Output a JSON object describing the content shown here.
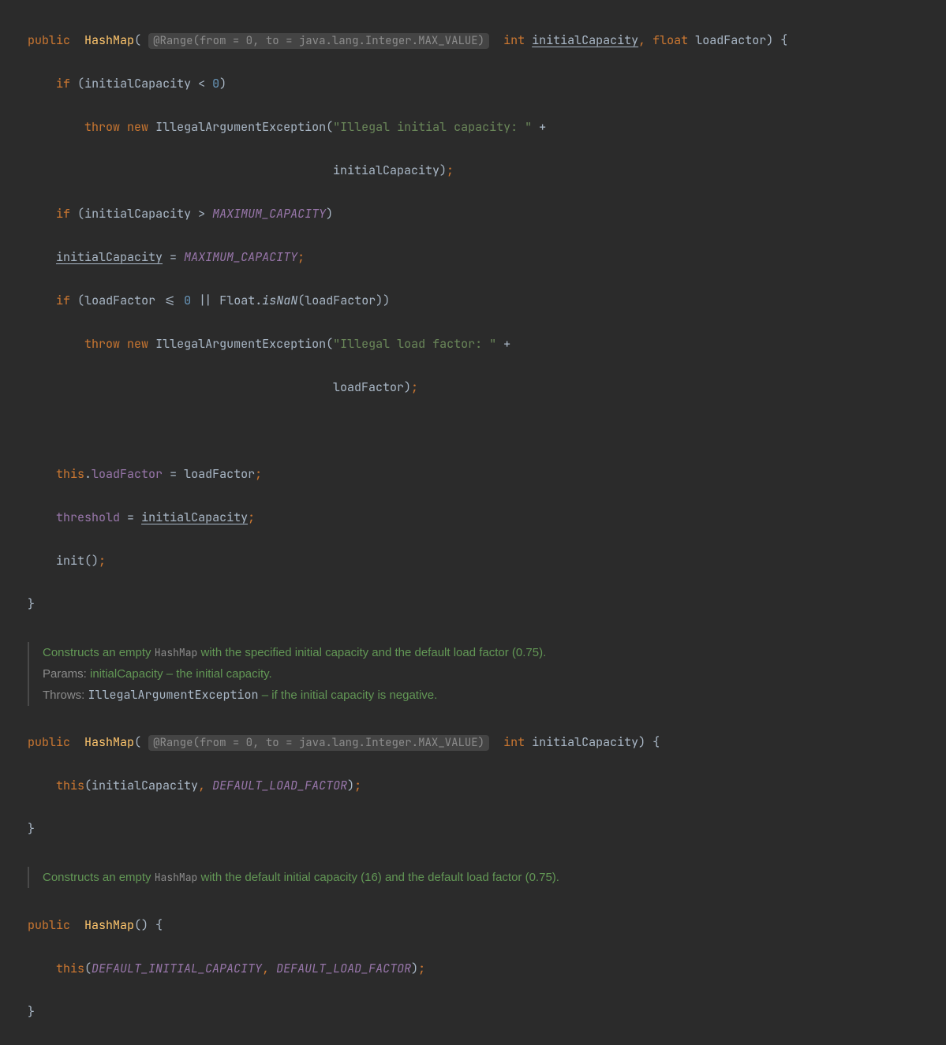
{
  "code": {
    "kw_public": "public",
    "kw_if": "if",
    "kw_throw": "throw",
    "kw_new": "new",
    "kw_this": "this",
    "type_int": "int",
    "type_float": "float",
    "method_hashmap": "HashMap",
    "param_initialCapacity": "initialCapacity",
    "param_loadFactor": "loadFactor",
    "annot_range": "@Range(from = 0, to = java.lang.Integer.MAX_VALUE)",
    "const_max_capacity": "MAXIMUM_CAPACITY",
    "const_default_load": "DEFAULT_LOAD_FACTOR",
    "const_default_cap": "DEFAULT_INITIAL_CAPACITY",
    "field_loadFactor": "loadFactor",
    "field_threshold": "threshold",
    "ex_class": "IllegalArgumentException",
    "str_illegal_cap": "\"Illegal initial capacity: \"",
    "str_illegal_load": "\"Illegal load factor: \"",
    "num_zero": "0",
    "call_init": "init",
    "static_float": "Float",
    "static_isnan": "isNaN"
  },
  "doc1": {
    "l1_a": "Constructs an empty",
    "l1_code": "HashMap",
    "l1_b": " with the specified initial capacity and the default load factor (0.75).",
    "l2_tag": "Params:",
    "l2_text": " initialCapacity – the initial capacity.",
    "l3_tag": "Throws:",
    "l3_link": "IllegalArgumentException",
    "l3_text": " – if the initial capacity is negative."
  },
  "doc2": {
    "l1_a": "Constructs an empty",
    "l1_code": "HashMap",
    "l1_b": " with the default initial capacity (16) and the default load factor (0.75)."
  }
}
